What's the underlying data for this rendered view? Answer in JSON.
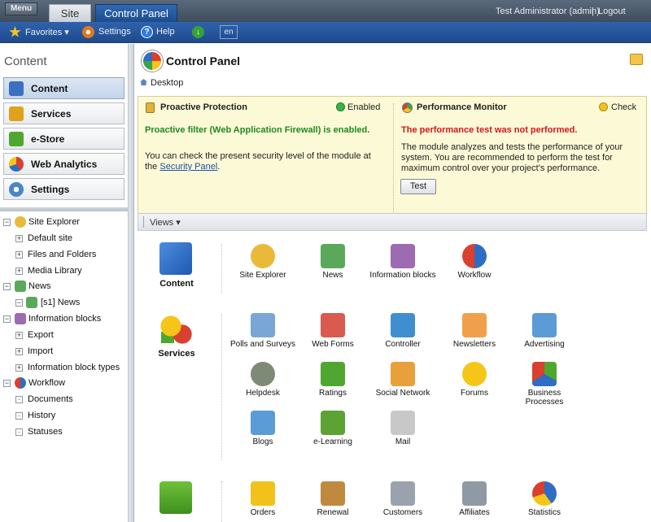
{
  "topbar": {
    "menu_label": "Menu",
    "tabs": [
      {
        "label": "Site"
      },
      {
        "label": "Control Panel"
      }
    ],
    "user_label": "Test Administrator (admin)",
    "separator": "|",
    "logout_label": "Logout"
  },
  "toolbar": {
    "favorites_label": "Favorites",
    "settings_label": "Settings",
    "help_label": "Help",
    "lang_label": "en"
  },
  "sidebar": {
    "title": "Content",
    "nav": [
      {
        "label": "Content",
        "active": true,
        "color": "#3b6fc2"
      },
      {
        "label": "Services",
        "active": false,
        "color": "#e0a21c"
      },
      {
        "label": "e-Store",
        "active": false,
        "color": "#4fa72f"
      },
      {
        "label": "Web Analytics",
        "active": false,
        "color": "#d9402e"
      },
      {
        "label": "Settings",
        "active": false,
        "color": "#4a86c7"
      }
    ],
    "tree": [
      {
        "label": "Site Explorer",
        "level": 0,
        "toggle": "-",
        "icon": "site-explorer-icon"
      },
      {
        "label": "Default site",
        "level": 1,
        "toggle": "+"
      },
      {
        "label": "Files and Folders",
        "level": 1,
        "toggle": "+"
      },
      {
        "label": "Media Library",
        "level": 1,
        "toggle": "+"
      },
      {
        "label": "News",
        "level": 0,
        "toggle": "-",
        "icon": "news-icon"
      },
      {
        "label": "[s1] News",
        "level": 1,
        "toggle": "-",
        "icon": "news-icon"
      },
      {
        "label": "Information blocks",
        "level": 0,
        "toggle": "-",
        "icon": "information-blocks-icon"
      },
      {
        "label": "Export",
        "level": 1,
        "toggle": "+"
      },
      {
        "label": "Import",
        "level": 1,
        "toggle": "+"
      },
      {
        "label": "Information block types",
        "level": 1,
        "toggle": "+"
      },
      {
        "label": "Workflow",
        "level": 0,
        "toggle": "-",
        "icon": "workflow-icon"
      },
      {
        "label": "Documents",
        "level": 1,
        "toggle": "·"
      },
      {
        "label": "History",
        "level": 1,
        "toggle": "·"
      },
      {
        "label": "Statuses",
        "level": 1,
        "toggle": "·"
      }
    ]
  },
  "main": {
    "title": "Control Panel",
    "breadcrumb": "Desktop",
    "proactive": {
      "title": "Proactive Protection",
      "status": "Enabled",
      "headline": "Proactive filter (Web Application Firewall) is enabled.",
      "text": "You can check the present security level of the module at the",
      "link": "Security Panel",
      "text_end": "."
    },
    "performance": {
      "title": "Performance Monitor",
      "status": "Check",
      "headline": "The performance test was not performed.",
      "text": "The module analyzes and tests the performance of your system. You are recommended to perform the test for maximum control over your project's performance.",
      "button": "Test"
    },
    "views_label": "Views",
    "categories": [
      {
        "label": "Content",
        "items": [
          "Site Explorer",
          "News",
          "Information blocks",
          "Workflow"
        ]
      },
      {
        "label": "Services",
        "items": [
          "Polls and Surveys",
          "Web Forms",
          "Controller",
          "Newsletters",
          "Advertising",
          "Helpdesk",
          "Ratings",
          "Social Network",
          "Forums",
          "Business Processes",
          "Blogs",
          "e-Learning",
          "Mail"
        ]
      },
      {
        "label": "",
        "items": [
          "Orders",
          "Renewal",
          "Customers",
          "Affiliates",
          "Statistics"
        ]
      }
    ]
  }
}
